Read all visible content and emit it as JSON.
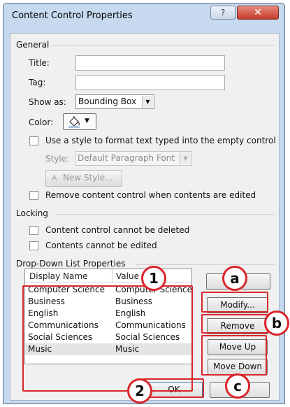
{
  "window": {
    "title": "Content Control Properties",
    "help_glyph": "?",
    "close_glyph": "✕"
  },
  "general": {
    "heading": "General",
    "title_label": "Title:",
    "title_value": "",
    "tag_label": "Tag:",
    "tag_value": "",
    "show_as_label": "Show as:",
    "show_as_value": "Bounding Box",
    "color_label": "Color:",
    "use_style_label": "Use a style to format text typed into the empty control",
    "style_label": "Style:",
    "style_value": "Default Paragraph Font",
    "new_style_label": "New Style...",
    "remove_cc_label": "Remove content control when contents are edited"
  },
  "locking": {
    "heading": "Locking",
    "cannot_delete_label": "Content control cannot be deleted",
    "cannot_edit_label": "Contents cannot be edited"
  },
  "dropdown": {
    "heading": "Drop-Down List Properties",
    "columns": [
      "Display Name",
      "Value"
    ],
    "rows": [
      {
        "display": "Computer Science",
        "value": "Computer Science"
      },
      {
        "display": "Business",
        "value": "Business"
      },
      {
        "display": "English",
        "value": "English"
      },
      {
        "display": "Communications",
        "value": "Communications"
      },
      {
        "display": "Social Sciences",
        "value": "Social Sciences"
      },
      {
        "display": "Music",
        "value": "Music"
      }
    ],
    "selected_row": "Music",
    "add_label": "",
    "modify_label": "Modify...",
    "remove_label": "Remove",
    "move_up_label": "Move Up",
    "move_down_label": "Move Down"
  },
  "footer": {
    "ok_label": "OK",
    "cancel_label": ""
  },
  "annotations": {
    "badge_1": "1",
    "badge_2": "2",
    "badge_a": "a",
    "badge_b": "b",
    "badge_c": "c",
    "color": "#d8262a"
  },
  "icons": {
    "color_picker": "paint-bucket-icon",
    "dropdown_arrow": "chevron-down-icon",
    "new_style": "style-icon"
  }
}
